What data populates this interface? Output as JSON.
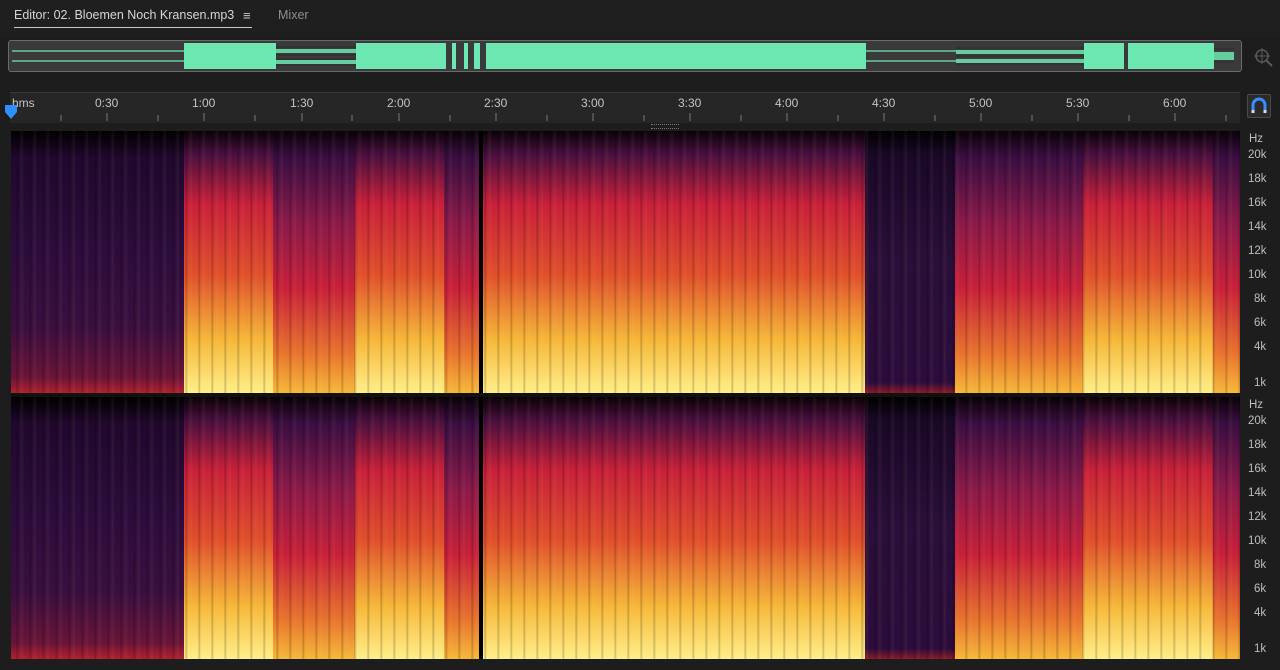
{
  "tabs": {
    "editor_label": "Editor: 02. Bloemen Noch Kransen.mp3",
    "menu_icon": "≡",
    "mixer_label": "Mixer"
  },
  "overview": {
    "waveform_color": "#6ee8b2",
    "icons": [
      "zoom-navigator-icon"
    ]
  },
  "ruler": {
    "unit_label": "hms",
    "ticks": [
      "0:30",
      "1:00",
      "1:30",
      "2:00",
      "2:30",
      "3:00",
      "3:30",
      "4:00",
      "4:30",
      "5:00",
      "5:30",
      "6:00"
    ],
    "playhead_color": "#2f8fff",
    "snap_icon": "magnet-icon"
  },
  "frequency_axis": {
    "unit": "Hz",
    "top_channel_labels": [
      "20k",
      "18k",
      "16k",
      "14k",
      "12k",
      "10k",
      "8k",
      "6k",
      "4k",
      "1k"
    ],
    "bottom_channel_labels": [
      "20k",
      "18k",
      "16k",
      "14k",
      "12k",
      "10k",
      "8k",
      "6k",
      "4k",
      "1k"
    ]
  },
  "spectral_colors": {
    "quiet": "#2a0f3a",
    "mid": "#c8203a",
    "loud": "#f6b83a",
    "peak": "#ffef8a"
  }
}
